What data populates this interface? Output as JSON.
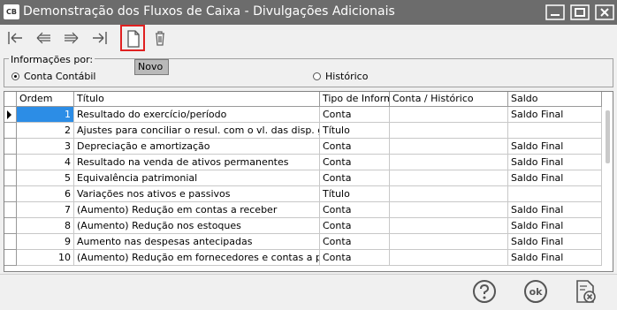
{
  "window": {
    "app_icon_text": "CB",
    "title": "Demonstração dos Fluxos de Caixa - Divulgações Adicionais"
  },
  "toolbar": {
    "tooltip": "Novo"
  },
  "filter": {
    "legend": "Informações por:",
    "options": [
      {
        "label": "Conta Contábil",
        "selected": true
      },
      {
        "label": "Histórico",
        "selected": false
      }
    ]
  },
  "grid": {
    "columns": [
      "Ordem",
      "Título",
      "Tipo de Informa",
      "Conta / Histórico",
      "Saldo"
    ],
    "rows": [
      {
        "ordem": "1",
        "titulo": "Resultado do exercício/período",
        "tipo": "Conta",
        "conta": "",
        "saldo": "Saldo Final"
      },
      {
        "ordem": "2",
        "titulo": "Ajustes para conciliar o resul. com o vl. das disp. geradas",
        "tipo": "Título",
        "conta": "",
        "saldo": ""
      },
      {
        "ordem": "3",
        "titulo": "Depreciação e amortização",
        "tipo": "Conta",
        "conta": "",
        "saldo": "Saldo Final"
      },
      {
        "ordem": "4",
        "titulo": "Resultado na venda de ativos permanentes",
        "tipo": "Conta",
        "conta": "",
        "saldo": "Saldo Final"
      },
      {
        "ordem": "5",
        "titulo": "Equivalência patrimonial",
        "tipo": "Conta",
        "conta": "",
        "saldo": "Saldo Final"
      },
      {
        "ordem": "6",
        "titulo": "Variações nos ativos e passivos",
        "tipo": "Título",
        "conta": "",
        "saldo": ""
      },
      {
        "ordem": "7",
        "titulo": "(Aumento) Redução em contas a receber",
        "tipo": "Conta",
        "conta": "",
        "saldo": "Saldo Final"
      },
      {
        "ordem": "8",
        "titulo": "(Aumento) Redução nos estoques",
        "tipo": "Conta",
        "conta": "",
        "saldo": "Saldo Final"
      },
      {
        "ordem": "9",
        "titulo": "Aumento nas despesas antecipadas",
        "tipo": "Conta",
        "conta": "",
        "saldo": "Saldo Final"
      },
      {
        "ordem": "10",
        "titulo": "(Aumento) Redução em fornecedores e contas a pagar",
        "tipo": "Conta",
        "conta": "",
        "saldo": "Saldo Final"
      }
    ]
  },
  "colors": {
    "titlebar": "#6c6c6c",
    "selection": "#2c8de6",
    "highlight_border": "#e02020"
  },
  "icons": [
    "first-record-icon",
    "previous-record-icon",
    "next-record-icon",
    "last-record-icon",
    "new-document-icon",
    "delete-icon",
    "help-icon",
    "ok-icon",
    "cancel-icon"
  ]
}
